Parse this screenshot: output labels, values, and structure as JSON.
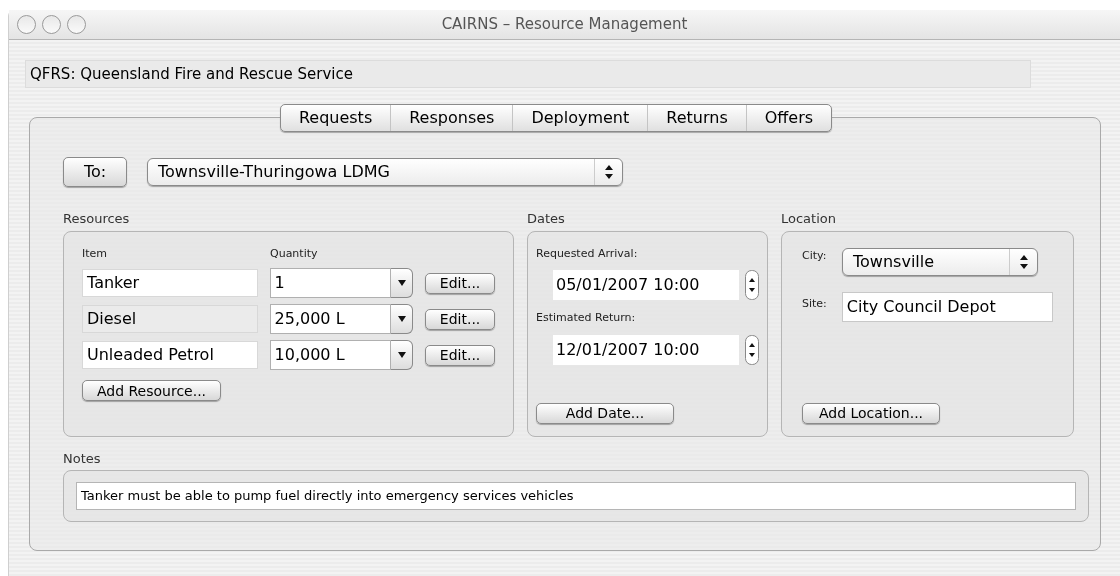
{
  "window": {
    "title": "CAIRNS – Resource Management"
  },
  "agency": "QFRS: Queensland Fire and Rescue Service",
  "tabs": [
    {
      "label": "Requests"
    },
    {
      "label": "Responses"
    },
    {
      "label": "Deployment"
    },
    {
      "label": "Returns"
    },
    {
      "label": "Offers"
    }
  ],
  "to": {
    "button": "To:",
    "value": "Townsville-Thuringowa LDMG"
  },
  "resources": {
    "title": "Resources",
    "columns": [
      "Item",
      "Quantity"
    ],
    "rows": [
      {
        "item": "Tanker",
        "disabled": false,
        "quantity": "1",
        "edit": "Edit..."
      },
      {
        "item": "Diesel",
        "disabled": true,
        "quantity": "25,000 L",
        "edit": "Edit..."
      },
      {
        "item": "Unleaded Petrol",
        "disabled": false,
        "quantity": "10,000 L",
        "edit": "Edit..."
      }
    ],
    "add": "Add Resource..."
  },
  "dates": {
    "title": "Dates",
    "fields": [
      {
        "label": "Requested Arrival:",
        "value": "05/01/2007 10:00"
      },
      {
        "label": "Estimated Return:",
        "value": "12/01/2007 10:00"
      }
    ],
    "add": "Add Date..."
  },
  "location": {
    "title": "Location",
    "city_label": "City:",
    "city": "Townsville",
    "site_label": "Site:",
    "site": "City Council Depot",
    "add": "Add Location..."
  },
  "notes": {
    "title": "Notes",
    "value": "Tanker must be able to pump fuel directly into emergency services vehicles"
  }
}
